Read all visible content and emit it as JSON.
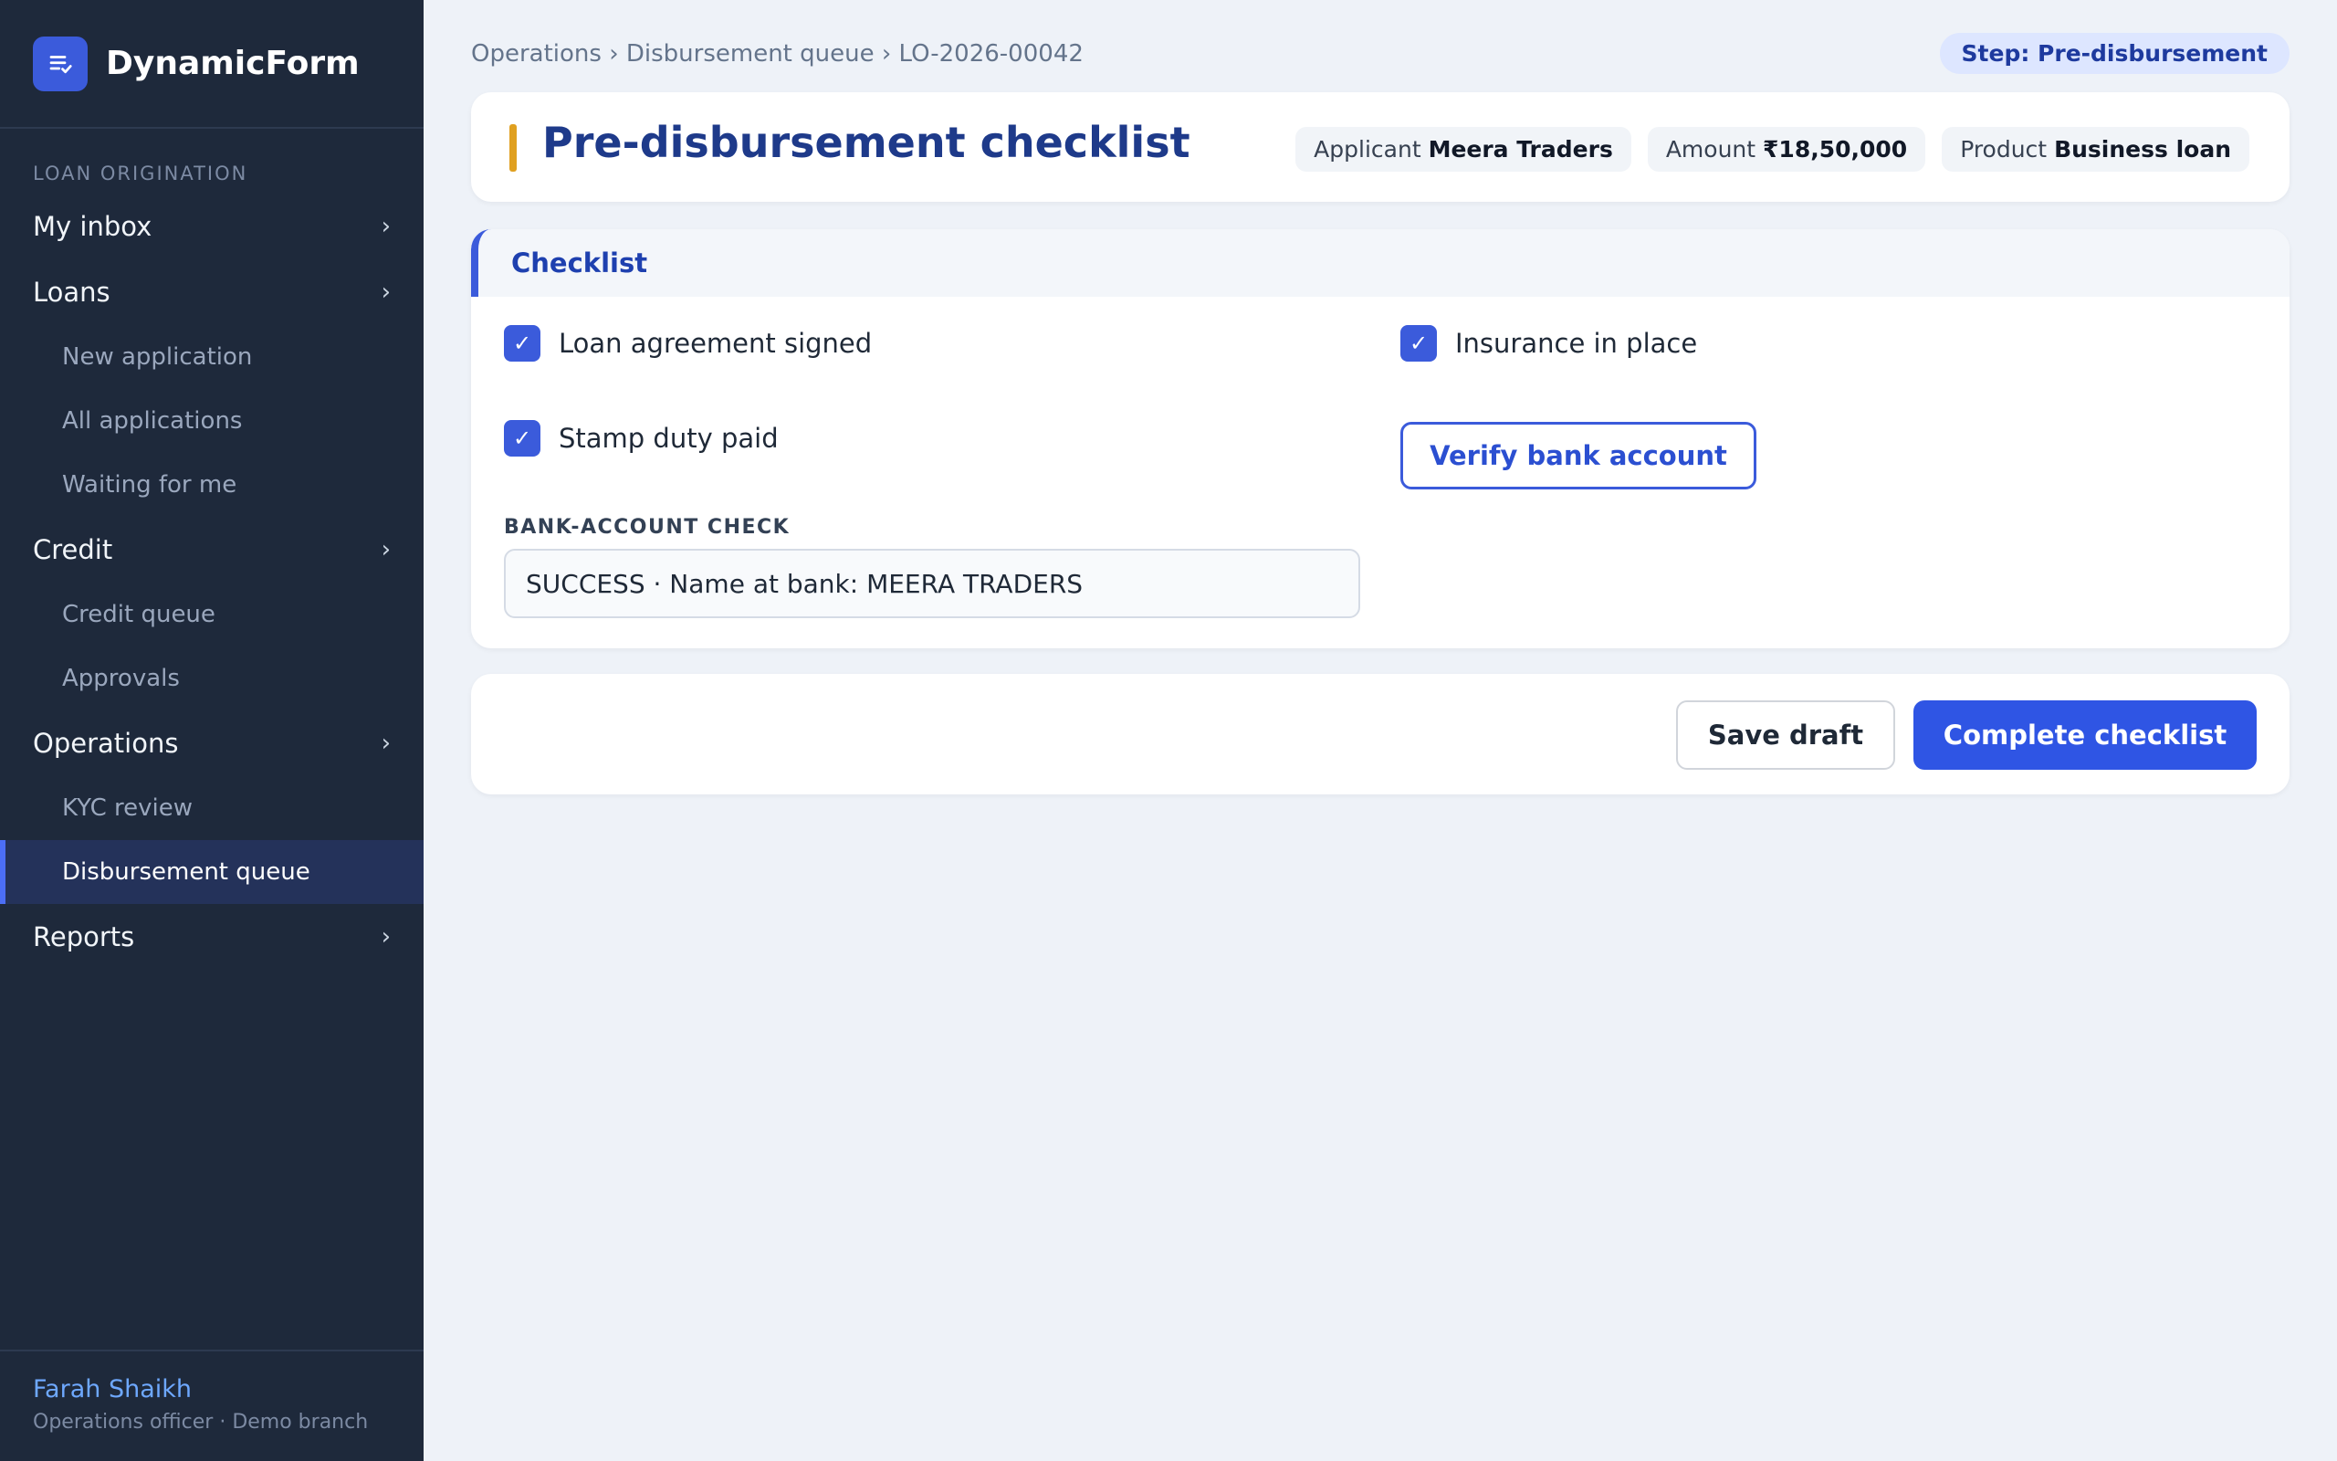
{
  "app": {
    "name": "DynamicForm",
    "logo_icon": "form-check-icon",
    "accent_color": "#3b5bdb"
  },
  "sidebar": {
    "section_label": "LOAN ORIGINATION",
    "groups": [
      {
        "label": "My inbox",
        "chevron": "›",
        "items": []
      },
      {
        "label": "Loans",
        "chevron": "›",
        "items": [
          "New application",
          "All applications",
          "Waiting for me"
        ]
      },
      {
        "label": "Credit",
        "chevron": "›",
        "items": [
          "Credit queue",
          "Approvals"
        ]
      },
      {
        "label": "Operations",
        "chevron": "›",
        "items": [
          "KYC review",
          "Disbursement queue"
        ]
      },
      {
        "label": "Reports",
        "chevron": "›",
        "items": []
      }
    ],
    "active_item": "Disbursement queue",
    "user": {
      "name": "Farah Shaikh",
      "role": "Operations officer · Demo branch"
    }
  },
  "breadcrumb": "Operations › Disbursement queue › LO-2026-00042",
  "step_badge": "Step: Pre-disbursement",
  "header": {
    "title": "Pre-disbursement checklist",
    "applicant_label": "Applicant",
    "applicant_value": "Meera Traders",
    "amount_label": "Amount",
    "amount_value": "₹18,50,000",
    "product_label": "Product",
    "product_value": "Business loan"
  },
  "checklist": {
    "section_title": "Checklist",
    "checkmark": "✓",
    "items": [
      {
        "label": "Loan agreement signed",
        "checked": true
      },
      {
        "label": "Insurance in place",
        "checked": true
      },
      {
        "label": "Stamp duty paid",
        "checked": true
      }
    ],
    "verify_button": "Verify bank account",
    "bank_check_label": "BANK-ACCOUNT CHECK",
    "bank_check_value": "SUCCESS · Name at bank: MEERA TRADERS"
  },
  "actions": {
    "save_draft": "Save draft",
    "complete": "Complete checklist"
  }
}
